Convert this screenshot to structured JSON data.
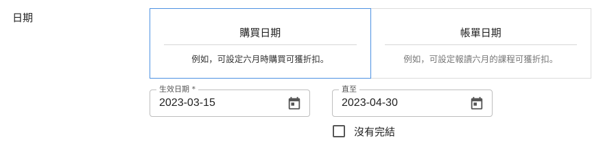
{
  "section": {
    "label": "日期"
  },
  "date_type": {
    "options": [
      {
        "title": "購買日期",
        "description": "例如，可設定六月時購買可獲折扣。",
        "selected": true
      },
      {
        "title": "帳單日期",
        "description": "例如，可設定報讀六月的課程可獲折扣。",
        "selected": false
      }
    ]
  },
  "start_date": {
    "label": "生效日期 *",
    "value": "2023-03-15",
    "icon": "calendar-icon"
  },
  "end_date": {
    "label": "直至",
    "value": "2023-04-30",
    "icon": "calendar-icon"
  },
  "no_end": {
    "label": "沒有完結",
    "checked": false
  },
  "colors": {
    "selected_border": "#4a90e2",
    "border": "#dcdcdc",
    "field_border": "#bdbdbd",
    "icon": "#555555"
  }
}
